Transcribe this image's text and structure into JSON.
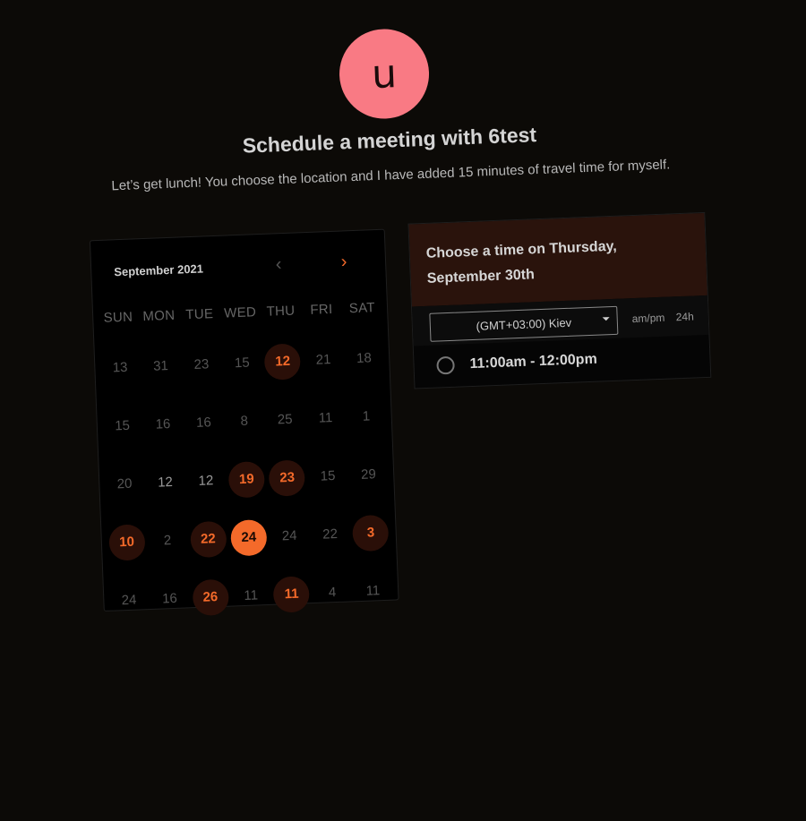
{
  "host": {
    "avatar_letter": "u",
    "avatar_color": "#f97a84"
  },
  "header": {
    "title": "Schedule a meeting with 6test",
    "description": "Let’s get lunch! You choose the location and I have added 15 minutes of travel time for myself."
  },
  "calendar": {
    "month_label": "September 2021",
    "prev_icon": "chevron-left-icon",
    "next_icon": "chevron-right-icon",
    "weekdays": [
      "SUN",
      "MON",
      "TUE",
      "WED",
      "THU",
      "FRI",
      "SAT"
    ],
    "weeks": [
      [
        {
          "n": "13",
          "s": "muted"
        },
        {
          "n": "31",
          "s": "muted"
        },
        {
          "n": "23",
          "s": "muted"
        },
        {
          "n": "15",
          "s": "muted"
        },
        {
          "n": "12",
          "s": "avail"
        },
        {
          "n": "21",
          "s": "muted"
        },
        {
          "n": "18",
          "s": "muted"
        }
      ],
      [
        {
          "n": "15",
          "s": "muted"
        },
        {
          "n": "16",
          "s": "muted"
        },
        {
          "n": "16",
          "s": "muted"
        },
        {
          "n": "8",
          "s": "muted"
        },
        {
          "n": "25",
          "s": "muted"
        },
        {
          "n": "11",
          "s": "muted"
        },
        {
          "n": "1",
          "s": "muted"
        }
      ],
      [
        {
          "n": "20",
          "s": "muted"
        },
        {
          "n": "12",
          "s": "mid"
        },
        {
          "n": "12",
          "s": "mid"
        },
        {
          "n": "19",
          "s": "avail"
        },
        {
          "n": "23",
          "s": "avail"
        },
        {
          "n": "15",
          "s": "muted"
        },
        {
          "n": "29",
          "s": "muted"
        }
      ],
      [
        {
          "n": "10",
          "s": "avail"
        },
        {
          "n": "2",
          "s": "muted"
        },
        {
          "n": "22",
          "s": "avail"
        },
        {
          "n": "24",
          "s": "selected"
        },
        {
          "n": "24",
          "s": "muted"
        },
        {
          "n": "22",
          "s": "muted"
        },
        {
          "n": "3",
          "s": "avail"
        }
      ],
      [
        {
          "n": "24",
          "s": "muted"
        },
        {
          "n": "16",
          "s": "muted"
        },
        {
          "n": "26",
          "s": "avail"
        },
        {
          "n": "11",
          "s": "muted"
        },
        {
          "n": "11",
          "s": "avail"
        },
        {
          "n": "4",
          "s": "muted"
        },
        {
          "n": "11",
          "s": "muted"
        }
      ]
    ],
    "accent_color": "#f46a2a"
  },
  "time_panel": {
    "title": "Choose a time on Thursday, September 30th",
    "timezone": "(GMT+03:00) Kiev",
    "format_ampm": "am/pm",
    "format_24h": "24h",
    "slots": [
      "11:00am - 12:00pm"
    ]
  }
}
